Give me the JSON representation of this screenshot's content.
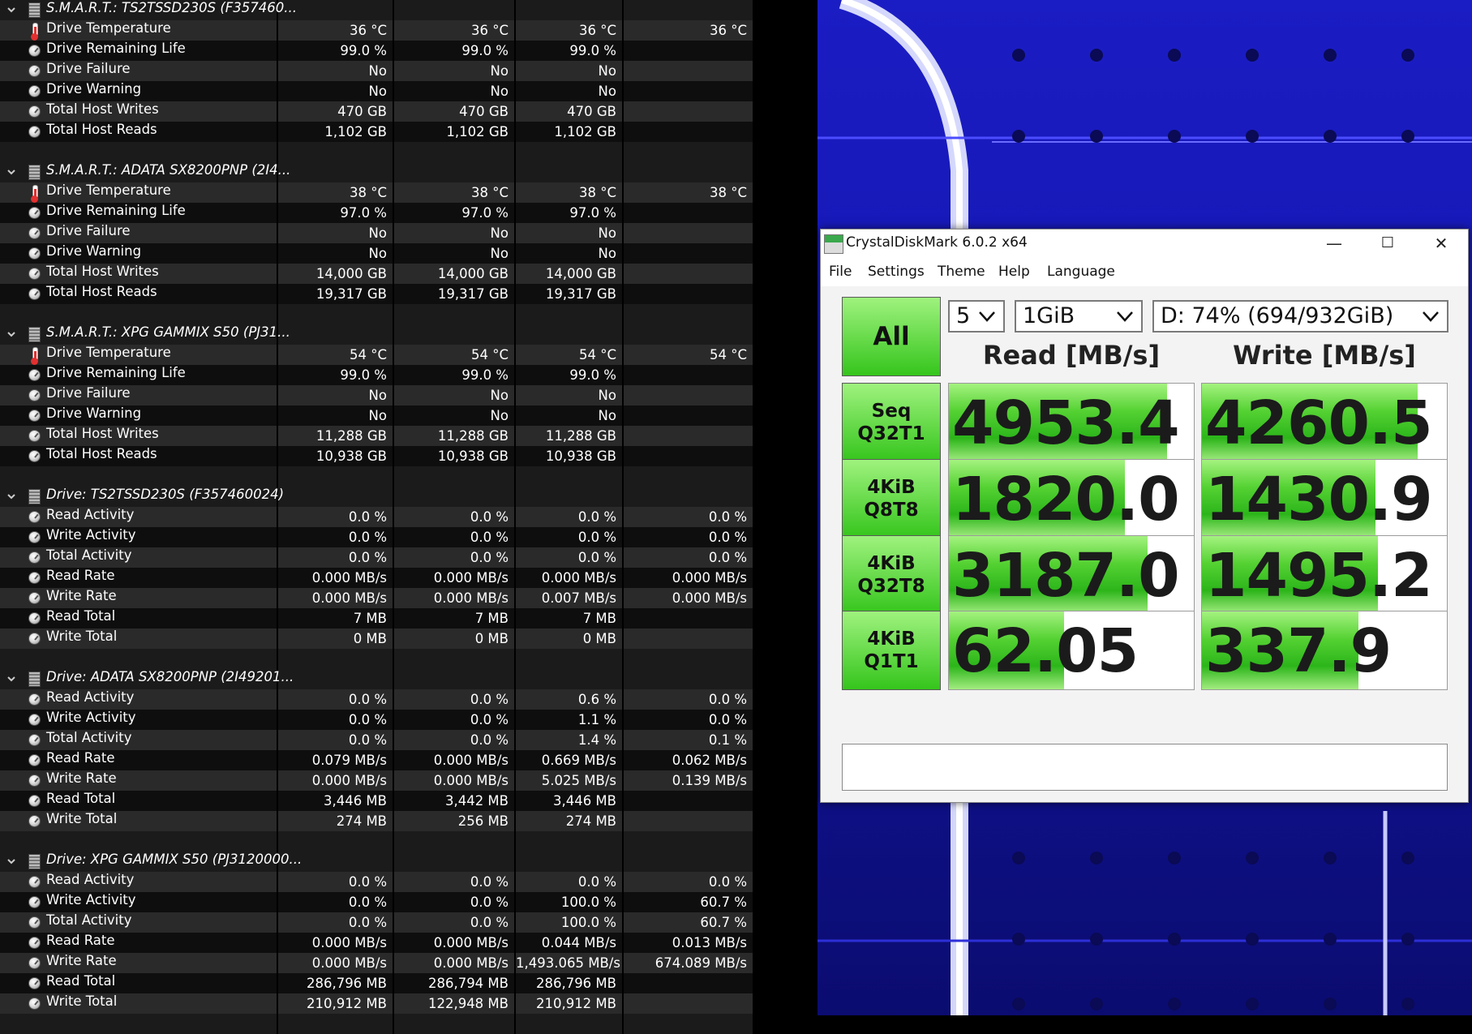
{
  "sensor_sections": [
    {
      "title": "S.M.A.R.T.: TS2TSSD230S (F357460...",
      "kind": "smart",
      "rows": [
        {
          "icon": "thermometer-icon",
          "label": "Drive Temperature",
          "v1": "36 °C",
          "v2": "36 °C",
          "v3": "36 °C",
          "v4": "36 °C"
        },
        {
          "icon": "gauge-icon",
          "label": "Drive Remaining Life",
          "v1": "99.0 %",
          "v2": "99.0 %",
          "v3": "99.0 %",
          "v4": ""
        },
        {
          "icon": "gauge-icon",
          "label": "Drive Failure",
          "v1": "No",
          "v2": "No",
          "v3": "No",
          "v4": ""
        },
        {
          "icon": "gauge-icon",
          "label": "Drive Warning",
          "v1": "No",
          "v2": "No",
          "v3": "No",
          "v4": ""
        },
        {
          "icon": "gauge-icon",
          "label": "Total Host Writes",
          "v1": "470 GB",
          "v2": "470 GB",
          "v3": "470 GB",
          "v4": ""
        },
        {
          "icon": "gauge-icon",
          "label": "Total Host Reads",
          "v1": "1,102 GB",
          "v2": "1,102 GB",
          "v3": "1,102 GB",
          "v4": ""
        }
      ]
    },
    {
      "title": "S.M.A.R.T.: ADATA SX8200PNP (2I4...",
      "kind": "smart",
      "rows": [
        {
          "icon": "thermometer-icon",
          "label": "Drive Temperature",
          "v1": "38 °C",
          "v2": "38 °C",
          "v3": "38 °C",
          "v4": "38 °C"
        },
        {
          "icon": "gauge-icon",
          "label": "Drive Remaining Life",
          "v1": "97.0 %",
          "v2": "97.0 %",
          "v3": "97.0 %",
          "v4": ""
        },
        {
          "icon": "gauge-icon",
          "label": "Drive Failure",
          "v1": "No",
          "v2": "No",
          "v3": "No",
          "v4": ""
        },
        {
          "icon": "gauge-icon",
          "label": "Drive Warning",
          "v1": "No",
          "v2": "No",
          "v3": "No",
          "v4": ""
        },
        {
          "icon": "gauge-icon",
          "label": "Total Host Writes",
          "v1": "14,000 GB",
          "v2": "14,000 GB",
          "v3": "14,000 GB",
          "v4": ""
        },
        {
          "icon": "gauge-icon",
          "label": "Total Host Reads",
          "v1": "19,317 GB",
          "v2": "19,317 GB",
          "v3": "19,317 GB",
          "v4": ""
        }
      ]
    },
    {
      "title": "S.M.A.R.T.: XPG GAMMIX S50 (PJ31...",
      "kind": "smart",
      "rows": [
        {
          "icon": "thermometer-icon",
          "label": "Drive Temperature",
          "v1": "54 °C",
          "v2": "54 °C",
          "v3": "54 °C",
          "v4": "54 °C"
        },
        {
          "icon": "gauge-icon",
          "label": "Drive Remaining Life",
          "v1": "99.0 %",
          "v2": "99.0 %",
          "v3": "99.0 %",
          "v4": ""
        },
        {
          "icon": "gauge-icon",
          "label": "Drive Failure",
          "v1": "No",
          "v2": "No",
          "v3": "No",
          "v4": ""
        },
        {
          "icon": "gauge-icon",
          "label": "Drive Warning",
          "v1": "No",
          "v2": "No",
          "v3": "No",
          "v4": ""
        },
        {
          "icon": "gauge-icon",
          "label": "Total Host Writes",
          "v1": "11,288 GB",
          "v2": "11,288 GB",
          "v3": "11,288 GB",
          "v4": ""
        },
        {
          "icon": "gauge-icon",
          "label": "Total Host Reads",
          "v1": "10,938 GB",
          "v2": "10,938 GB",
          "v3": "10,938 GB",
          "v4": ""
        }
      ]
    },
    {
      "title": "Drive: TS2TSSD230S (F357460024)",
      "kind": "drive",
      "rows": [
        {
          "icon": "gauge-icon",
          "label": "Read Activity",
          "v1": "0.0 %",
          "v2": "0.0 %",
          "v3": "0.0 %",
          "v4": "0.0 %"
        },
        {
          "icon": "gauge-icon",
          "label": "Write Activity",
          "v1": "0.0 %",
          "v2": "0.0 %",
          "v3": "0.0 %",
          "v4": "0.0 %"
        },
        {
          "icon": "gauge-icon",
          "label": "Total Activity",
          "v1": "0.0 %",
          "v2": "0.0 %",
          "v3": "0.0 %",
          "v4": "0.0 %"
        },
        {
          "icon": "gauge-icon",
          "label": "Read Rate",
          "v1": "0.000 MB/s",
          "v2": "0.000 MB/s",
          "v3": "0.000 MB/s",
          "v4": "0.000 MB/s"
        },
        {
          "icon": "gauge-icon",
          "label": "Write Rate",
          "v1": "0.000 MB/s",
          "v2": "0.000 MB/s",
          "v3": "0.007 MB/s",
          "v4": "0.000 MB/s"
        },
        {
          "icon": "gauge-icon",
          "label": "Read Total",
          "v1": "7 MB",
          "v2": "7 MB",
          "v3": "7 MB",
          "v4": ""
        },
        {
          "icon": "gauge-icon",
          "label": "Write Total",
          "v1": "0 MB",
          "v2": "0 MB",
          "v3": "0 MB",
          "v4": ""
        }
      ]
    },
    {
      "title": "Drive: ADATA SX8200PNP (2I49201...",
      "kind": "drive",
      "rows": [
        {
          "icon": "gauge-icon",
          "label": "Read Activity",
          "v1": "0.0 %",
          "v2": "0.0 %",
          "v3": "0.6 %",
          "v4": "0.0 %"
        },
        {
          "icon": "gauge-icon",
          "label": "Write Activity",
          "v1": "0.0 %",
          "v2": "0.0 %",
          "v3": "1.1 %",
          "v4": "0.0 %"
        },
        {
          "icon": "gauge-icon",
          "label": "Total Activity",
          "v1": "0.0 %",
          "v2": "0.0 %",
          "v3": "1.4 %",
          "v4": "0.1 %"
        },
        {
          "icon": "gauge-icon",
          "label": "Read Rate",
          "v1": "0.079 MB/s",
          "v2": "0.000 MB/s",
          "v3": "0.669 MB/s",
          "v4": "0.062 MB/s"
        },
        {
          "icon": "gauge-icon",
          "label": "Write Rate",
          "v1": "0.000 MB/s",
          "v2": "0.000 MB/s",
          "v3": "5.025 MB/s",
          "v4": "0.139 MB/s"
        },
        {
          "icon": "gauge-icon",
          "label": "Read Total",
          "v1": "3,446 MB",
          "v2": "3,442 MB",
          "v3": "3,446 MB",
          "v4": ""
        },
        {
          "icon": "gauge-icon",
          "label": "Write Total",
          "v1": "274 MB",
          "v2": "256 MB",
          "v3": "274 MB",
          "v4": ""
        }
      ]
    },
    {
      "title": "Drive: XPG GAMMIX S50 (PJ3120000...",
      "kind": "drive",
      "rows": [
        {
          "icon": "gauge-icon",
          "label": "Read Activity",
          "v1": "0.0 %",
          "v2": "0.0 %",
          "v3": "0.0 %",
          "v4": "0.0 %"
        },
        {
          "icon": "gauge-icon",
          "label": "Write Activity",
          "v1": "0.0 %",
          "v2": "0.0 %",
          "v3": "100.0 %",
          "v4": "60.7 %"
        },
        {
          "icon": "gauge-icon",
          "label": "Total Activity",
          "v1": "0.0 %",
          "v2": "0.0 %",
          "v3": "100.0 %",
          "v4": "60.7 %"
        },
        {
          "icon": "gauge-icon",
          "label": "Read Rate",
          "v1": "0.000 MB/s",
          "v2": "0.000 MB/s",
          "v3": "0.044 MB/s",
          "v4": "0.013 MB/s"
        },
        {
          "icon": "gauge-icon",
          "label": "Write Rate",
          "v1": "0.000 MB/s",
          "v2": "0.000 MB/s",
          "v3": "1,493.065 MB/s",
          "v4": "674.089 MB/s"
        },
        {
          "icon": "gauge-icon",
          "label": "Read Total",
          "v1": "286,796 MB",
          "v2": "286,794 MB",
          "v3": "286,796 MB",
          "v4": ""
        },
        {
          "icon": "gauge-icon",
          "label": "Write Total",
          "v1": "210,912 MB",
          "v2": "122,948 MB",
          "v3": "210,912 MB",
          "v4": ""
        }
      ]
    }
  ],
  "cdm": {
    "title": "CrystalDiskMark 6.0.2 x64",
    "minimize_glyph": "—",
    "maximize_glyph": "☐",
    "close_glyph": "✕",
    "menu": [
      "File",
      "Settings",
      "Theme",
      "Help",
      "Language"
    ],
    "all_label": "All",
    "count_value": "5",
    "size_value": "1GiB",
    "drive_value": "D: 74% (694/932GiB)",
    "read_header": "Read [MB/s]",
    "write_header": "Write [MB/s]",
    "tests": [
      {
        "line1": "Seq",
        "line2": "Q32T1",
        "read": "4953.4",
        "read_fill": 0.89,
        "write": "4260.5",
        "write_fill": 0.88
      },
      {
        "line1": "4KiB",
        "line2": "Q8T8",
        "read": "1820.0",
        "read_fill": 0.72,
        "write": "1430.9",
        "write_fill": 0.71
      },
      {
        "line1": "4KiB",
        "line2": "Q32T8",
        "read": "3187.0",
        "read_fill": 0.81,
        "write": "1495.2",
        "write_fill": 0.72
      },
      {
        "line1": "4KiB",
        "line2": "Q1T1",
        "read": "62.05",
        "read_fill": 0.47,
        "write": "337.9",
        "write_fill": 0.64
      }
    ],
    "comment": ""
  }
}
